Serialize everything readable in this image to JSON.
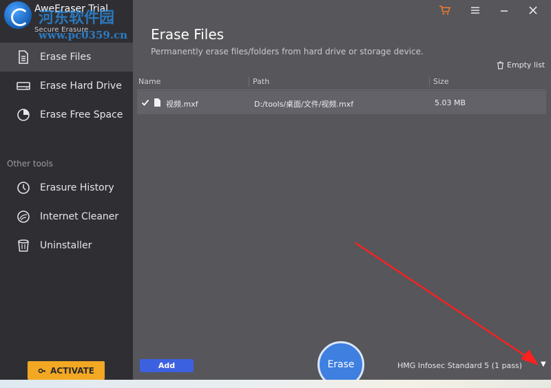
{
  "app": {
    "title": "AweEraser Trial",
    "subtitle": "Secure Erasure"
  },
  "watermark": {
    "cn": "河东软件园",
    "url": "www.pc0359.cn"
  },
  "sidebar": {
    "items": [
      {
        "label": "Erase Files",
        "icon": "file-icon"
      },
      {
        "label": "Erase Hard Drive",
        "icon": "hard-drive-icon"
      },
      {
        "label": "Erase Free Space",
        "icon": "pie-chart-icon"
      }
    ],
    "other_tools_label": "Other tools",
    "other_tools": [
      {
        "label": "Erasure History",
        "icon": "clock-icon"
      },
      {
        "label": "Internet Cleaner",
        "icon": "globe-cleaner-icon"
      },
      {
        "label": "Uninstaller",
        "icon": "trash-can-icon"
      }
    ],
    "activate_label": "ACTIVATE"
  },
  "main": {
    "title": "Erase Files",
    "subtitle": "Permanently erase files/folders from hard drive or storage device.",
    "empty_list_label": "Empty list",
    "table": {
      "columns": [
        "Name",
        "Path",
        "Size"
      ],
      "rows": [
        {
          "name": "视频.mxf",
          "path": "D:/tools/桌面/文件/视频.mxf",
          "size": "5.03 MB",
          "checked": true
        }
      ]
    },
    "add_label": "Add",
    "erase_label": "Erase",
    "method_label": "HMG Infosec Standard 5 (1 pass)"
  },
  "colors": {
    "accent": "#3e7fe0",
    "add_button": "#3c61e0",
    "activate": "#f2a823",
    "annotation_arrow": "#ff2020"
  }
}
